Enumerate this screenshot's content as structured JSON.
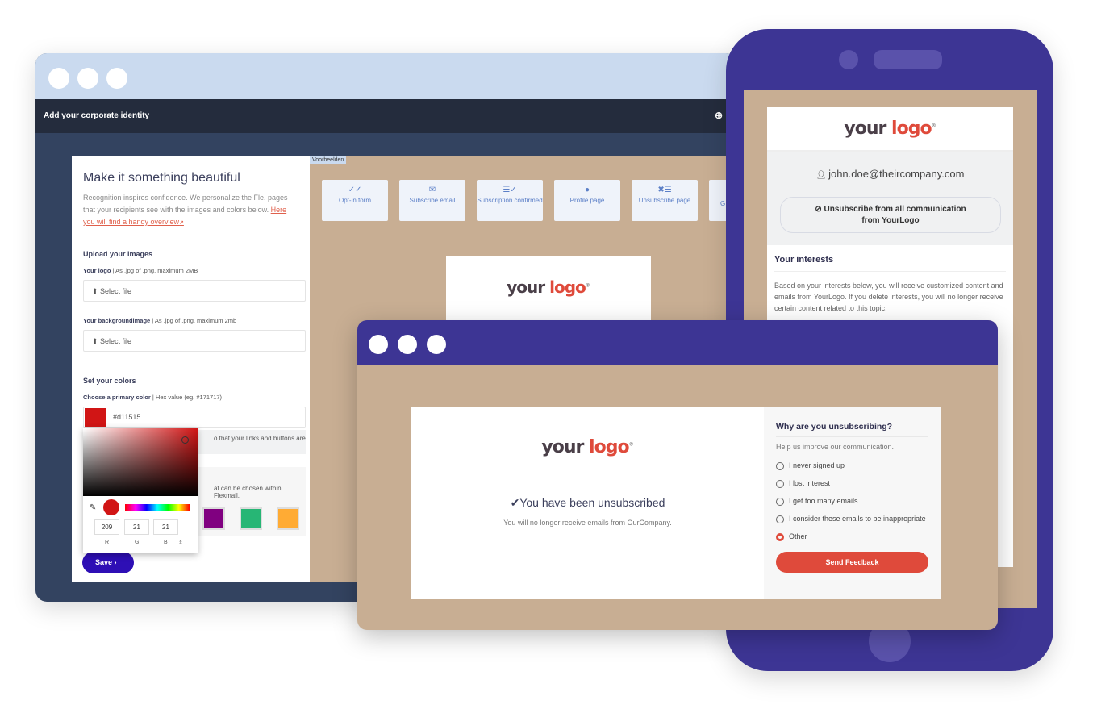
{
  "back_window": {
    "header_title": "Add your corporate identity",
    "left_panel": {
      "title": "Make it something beautiful",
      "intro": "Recognition inspires confidence. We personalize the Fle. pages that your recipients see with the images and colors below.",
      "overview_link": "Here you will find a handy overview",
      "upload_heading": "Upload your images",
      "logo_label": "Your logo",
      "logo_hint": "As .jpg of .png, maximum 2MB",
      "background_label": "Your backgroundimage",
      "background_hint": "As .jpg of .png, maximum 2mb",
      "select_file": "Select file",
      "colors_heading": "Set your colors",
      "primary_label": "Choose a primary color",
      "primary_hint": "Hex value (eg. #171717)",
      "primary_value": "#d11515",
      "primary_color": "#d11515",
      "info_fragment": "o that your links and buttons are",
      "palette_fragment": "at can be chosen within Flexmail.",
      "palette_colors": [
        "#800080",
        "#27b675",
        "#ffab34"
      ],
      "save_label": "Save"
    },
    "color_picker": {
      "r": "209",
      "g": "21",
      "b": "21",
      "r_label": "R",
      "g_label": "G",
      "b_label": "B"
    },
    "preview": {
      "tab_label": "Voorbeelden",
      "tiles": [
        {
          "label": "Opt-in form",
          "icon": "double-check-icon"
        },
        {
          "label": "Subscribe email",
          "icon": "envelope-icon"
        },
        {
          "label": "Subscription confirmed",
          "icon": "list-check-icon"
        },
        {
          "label": "Profile page",
          "icon": "person-icon"
        },
        {
          "label": "Unsubscribe page",
          "icon": "list-x-icon"
        },
        {
          "label": "G"
        }
      ]
    }
  },
  "logo": {
    "your": "your",
    "logo": "logo",
    "mark": "®"
  },
  "phone": {
    "email": "john.doe@theircompany.com",
    "unsubscribe_all": "Unsubscribe from all communication from YourLogo",
    "interests_title": "Your interests",
    "interests_text": "Based on your interests below, you will receive customized content and emails from YourLogo. If you delete interests, you will no longer receive certain content related to this topic."
  },
  "front_window": {
    "status_title": "You have been unsubscribed",
    "status_text": "You will no longer receive emails from OurCompany.",
    "survey_title": "Why are you unsubscribing?",
    "survey_subtitle": "Help us improve our communication.",
    "options": [
      {
        "label": "I never signed up",
        "selected": false
      },
      {
        "label": "I lost interest",
        "selected": false
      },
      {
        "label": "I get too many emails",
        "selected": false
      },
      {
        "label": "I consider these emails to be inappropriate",
        "selected": false
      },
      {
        "label": "Other",
        "selected": true
      }
    ],
    "send_label": "Send Feedback"
  },
  "colors": {
    "accent_purple": "#3d3594",
    "tan": "#c8ae93",
    "red": "#df4a3b",
    "save_button": "#2e0fb5"
  }
}
